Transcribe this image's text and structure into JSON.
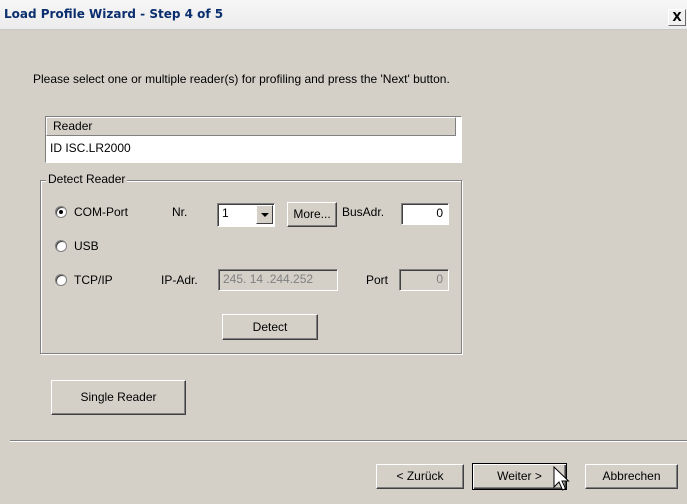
{
  "window": {
    "title": "Load Profile Wizard - Step 4 of 5",
    "close_label": "X"
  },
  "instruction": "Please select one or multiple reader(s) for profiling and press the 'Next' button.",
  "reader_list": {
    "header": "Reader",
    "rows": [
      "ID ISC.LR2000"
    ]
  },
  "detect_reader": {
    "legend": "Detect Reader",
    "options": [
      {
        "label": "COM-Port",
        "checked": true
      },
      {
        "label": "USB",
        "checked": false
      },
      {
        "label": "TCP/IP",
        "checked": false
      }
    ],
    "nr_label": "Nr.",
    "nr_value": "1",
    "more_button": "More...",
    "busadr_label": "BusAdr.",
    "busadr_value": "0",
    "ipadr_label": "IP-Adr.",
    "ipadr_value": "245. 14 .244.252",
    "port_label": "Port",
    "port_value": "0",
    "detect_button": "Detect"
  },
  "single_reader_button": "Single Reader",
  "footer": {
    "back_button": "< Zurück",
    "next_button": "Weiter >",
    "cancel_button": "Abbrechen"
  }
}
